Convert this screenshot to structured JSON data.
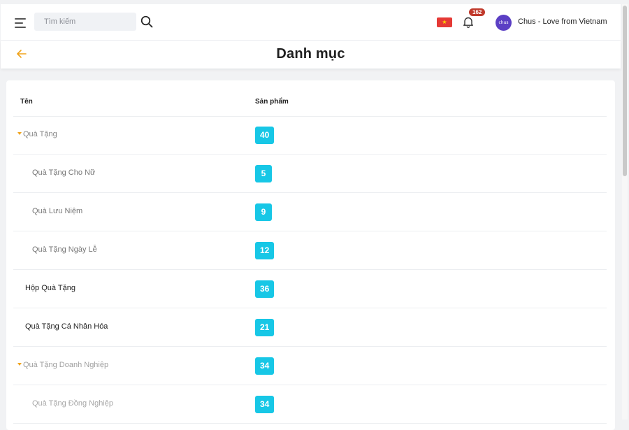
{
  "header": {
    "search_placeholder": "Tìm kiếm",
    "notification_count": "162",
    "avatar_text": "chus",
    "user_name": "Chus - Love from Vietnam",
    "flag_star": "★"
  },
  "page": {
    "title": "Danh mục"
  },
  "table": {
    "col_name": "Tên",
    "col_products": "Sản phẩm",
    "rows": [
      {
        "name": "Quà Tặng",
        "count": "40",
        "level": 0,
        "expandable": true
      },
      {
        "name": "Quà Tặng Cho Nữ",
        "count": "5",
        "level": 1,
        "expandable": false
      },
      {
        "name": "Quà Lưu Niệm",
        "count": "9",
        "level": 1,
        "expandable": false
      },
      {
        "name": "Quà Tặng Ngày Lễ",
        "count": "12",
        "level": 1,
        "expandable": false
      },
      {
        "name": "Hộp Quà Tặng",
        "count": "36",
        "level": 0,
        "expandable": false
      },
      {
        "name": "Quà Tặng Cá Nhân Hóa",
        "count": "21",
        "level": 0,
        "expandable": false
      },
      {
        "name": "Quà Tặng Doanh Nghiệp",
        "count": "34",
        "level": 0,
        "expandable": true
      },
      {
        "name": "Quà Tặng Đồng Nghiệp",
        "count": "34",
        "level": 1,
        "expandable": false
      }
    ]
  },
  "colors": {
    "accent": "#f0a31c",
    "count_badge": "#17c7e6",
    "notification_badge": "#c0392b",
    "avatar": "#5b3fc4",
    "flag": "#e53935"
  }
}
